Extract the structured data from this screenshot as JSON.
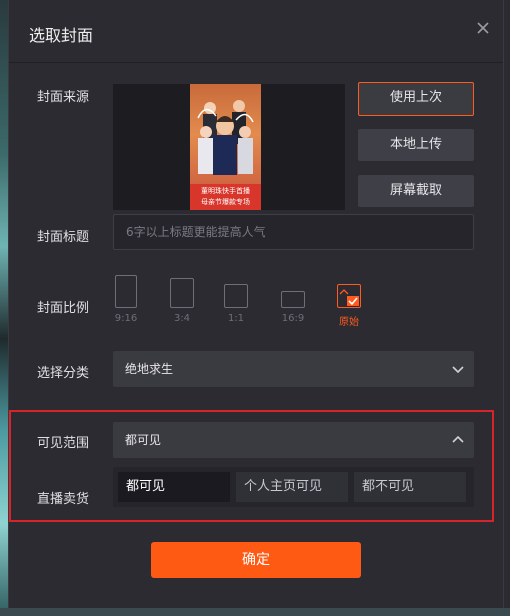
{
  "dialog": {
    "title": "选取封面",
    "close_icon": "close-icon"
  },
  "cover_source": {
    "label": "封面来源",
    "poster_caption_line1": "董明珠快手首播",
    "poster_caption_line2": "母亲节爆款专场",
    "buttons": {
      "use_last": "使用上次",
      "local_upload": "本地上传",
      "screenshot": "屏幕截取"
    }
  },
  "cover_title": {
    "label": "封面标题",
    "placeholder": "6字以上标题更能提高人气"
  },
  "cover_ratio": {
    "label": "封面比例",
    "options": [
      "9:16",
      "3:4",
      "1:1",
      "16:9",
      "原始"
    ],
    "selected": "原始"
  },
  "category": {
    "label": "选择分类",
    "value": "绝地求生"
  },
  "visibility": {
    "label": "可见范围",
    "value": "都可见"
  },
  "live_sale": {
    "label": "直播卖货",
    "options": [
      "都可见",
      "个人主页可见",
      "都不可见"
    ],
    "selected": "都可见"
  },
  "confirm_label": "确定",
  "colors": {
    "accent": "#ff5a14",
    "highlight_border": "#d8232a",
    "background": "#2b2b31"
  }
}
